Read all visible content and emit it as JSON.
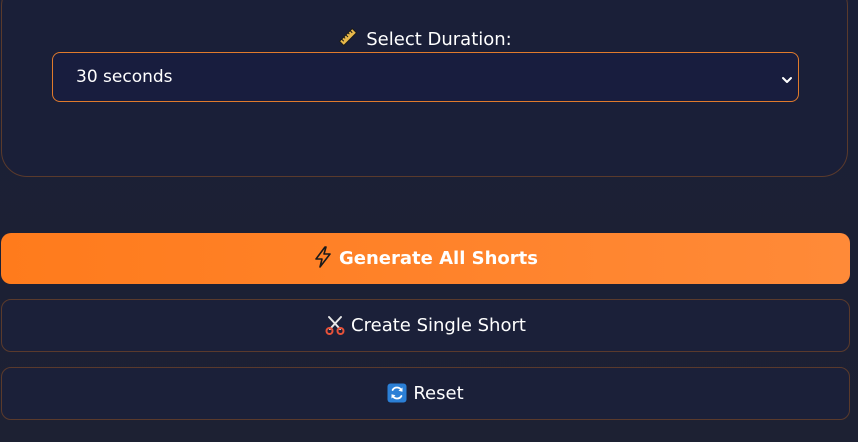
{
  "duration": {
    "label": "Select Duration:",
    "icon": "ruler-icon",
    "selected": "30 seconds"
  },
  "actions": {
    "generate_all_label": "Generate All Shorts",
    "generate_all_icon": "lightning-icon",
    "create_single_label": "Create Single Short",
    "create_single_icon": "scissors-icon",
    "reset_label": "Reset",
    "reset_icon": "refresh-icon"
  },
  "colors": {
    "accent": "#ff7b1c",
    "border": "#5a3a2c",
    "select_border": "#e07a2c",
    "background": "#1b2036"
  }
}
